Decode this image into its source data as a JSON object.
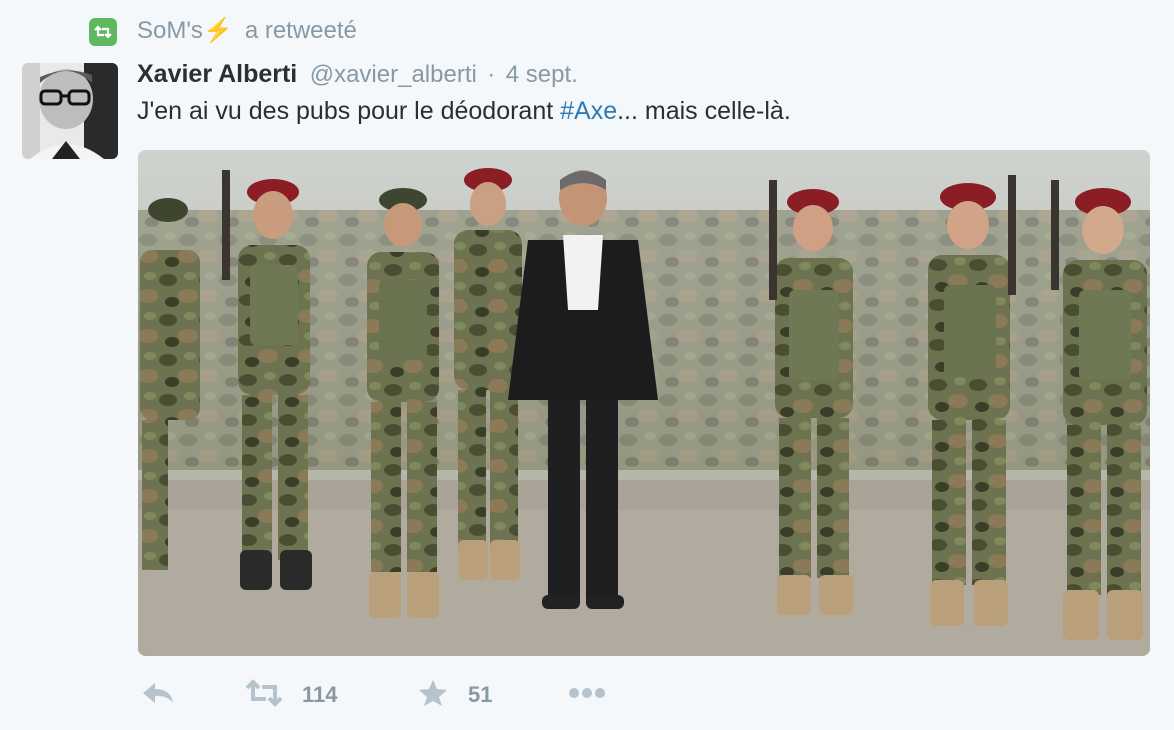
{
  "retweet_context": {
    "icon": "retweet-icon",
    "user": "SoM's",
    "emoji": "⚡",
    "suffix": "a retweeté"
  },
  "tweet": {
    "author_name": "Xavier Alberti",
    "handle": "@xavier_alberti",
    "separator": "·",
    "time": "4 sept.",
    "text_before": "J'en ai vu des pubs pour le déodorant ",
    "hashtag": "#Axe",
    "text_after": "... mais celle-là.",
    "avatar_icon": "avatar",
    "media": {
      "description_icon": "photo",
      "background": "#b9b2a4"
    }
  },
  "actions": {
    "reply_icon": "reply-icon",
    "retweet_icon": "retweet-icon",
    "retweet_count": "114",
    "favorite_icon": "star-icon",
    "favorite_count": "51",
    "more_icon": "more-dots-icon"
  },
  "colors": {
    "background": "#f5f8fa",
    "text": "#292f33",
    "muted": "#8899a6",
    "link": "#2b7bb9",
    "retweet_green": "#5fb85f"
  }
}
